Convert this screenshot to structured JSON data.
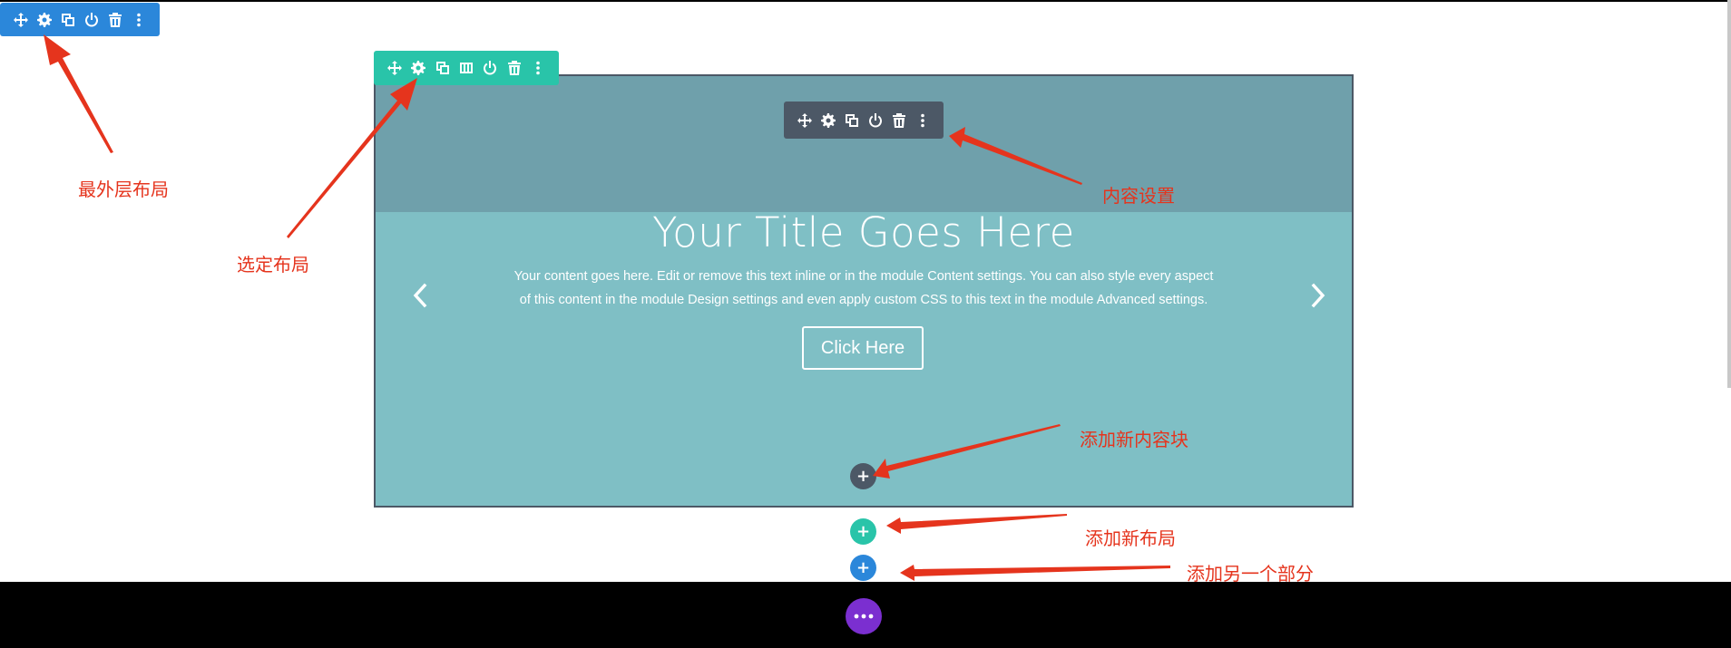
{
  "annotations": {
    "section": "最外层布局",
    "row": "选定布局",
    "module": "内容设置",
    "add_module": "添加新内容块",
    "add_row": "添加新布局",
    "add_section": "添加另一个部分"
  },
  "slide": {
    "title": "Your Title Goes Here",
    "text_line1": "Your content goes here. Edit or remove this text inline or in the module Content settings. You can also style every aspect",
    "text_line2": "of this content in the module Design settings and even apply custom CSS to this text in the module Advanced settings.",
    "button_label": "Click Here"
  },
  "toolbars": {
    "section": [
      "move-icon",
      "gear-icon",
      "duplicate-icon",
      "power-icon",
      "trash-icon",
      "more-vertical-icon"
    ],
    "row": [
      "move-icon",
      "gear-icon",
      "duplicate-icon",
      "columns-icon",
      "power-icon",
      "trash-icon",
      "more-vertical-icon"
    ],
    "module": [
      "move-icon",
      "gear-icon",
      "duplicate-icon",
      "power-icon",
      "trash-icon",
      "more-vertical-icon"
    ]
  },
  "add_buttons": {
    "module": "+",
    "row": "+",
    "section": "+"
  },
  "colors": {
    "section": "#2b87da",
    "row": "#29c4a9",
    "module": "#4c5866",
    "slider_top": "#6fa0ab",
    "slider_body": "#7fbfc5",
    "page_settings": "#7b2fd0",
    "annotation": "#e5341d"
  }
}
